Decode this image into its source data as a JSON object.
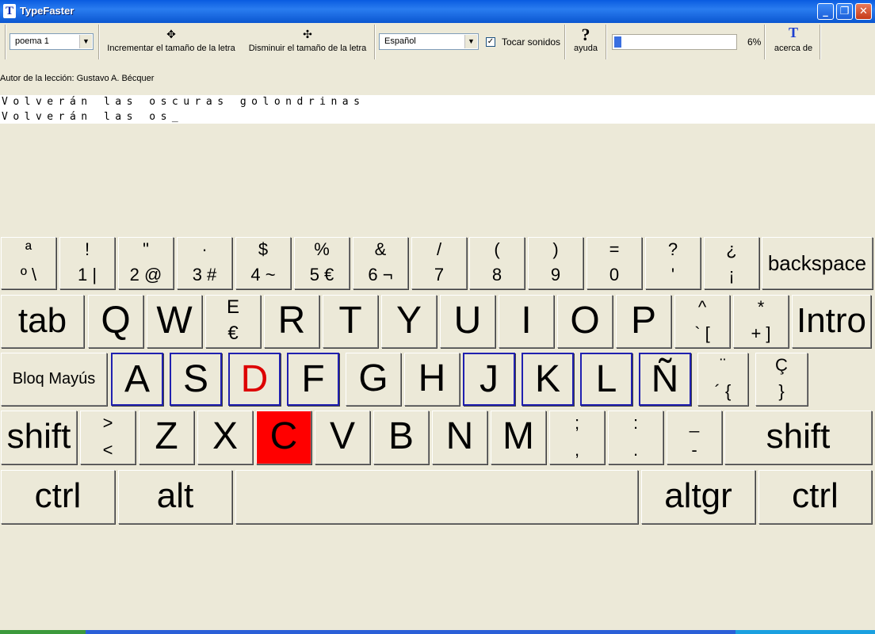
{
  "window": {
    "title": "TypeFaster",
    "icon": "T"
  },
  "toolbar": {
    "lesson_value": "poema 1",
    "increase_label": "Incrementar el tamaño de la letra",
    "decrease_label": "Disminuir el tamaño de la letra",
    "language_value": "Español",
    "sound_label": "Tocar sonidos",
    "sound_checked": true,
    "help_label": "ayuda",
    "help_icon": "?",
    "about_label": "acerca de",
    "about_icon": "T",
    "progress_percent": 6,
    "progress_label": "6%"
  },
  "author": "Autor de la lección: Gustavo A. Bécquer",
  "lesson": {
    "target": "Volverán las oscuras golondrinas",
    "typed": "Volverán las os_"
  },
  "keyboard": {
    "row1": [
      {
        "top": "ª",
        "bot": "º \\"
      },
      {
        "top": "!",
        "bot": "1 |"
      },
      {
        "top": "\"",
        "bot": "2 @"
      },
      {
        "top": "·",
        "bot": "3 #"
      },
      {
        "top": "$",
        "bot": "4 ~"
      },
      {
        "top": "%",
        "bot": "5 €"
      },
      {
        "top": "&",
        "bot": "6 ¬"
      },
      {
        "top": "/",
        "bot": "7"
      },
      {
        "top": "(",
        "bot": "8"
      },
      {
        "top": ")",
        "bot": "9"
      },
      {
        "top": "=",
        "bot": "0"
      },
      {
        "top": "?",
        "bot": "'"
      },
      {
        "top": "¿",
        "bot": "¡"
      },
      {
        "word": "backspace"
      }
    ],
    "row2": [
      {
        "word": "tab"
      },
      {
        "big": "Q"
      },
      {
        "big": "W"
      },
      {
        "top": "E",
        "bot": "€"
      },
      {
        "big": "R"
      },
      {
        "big": "T"
      },
      {
        "big": "Y"
      },
      {
        "big": "U"
      },
      {
        "big": "I"
      },
      {
        "big": "O"
      },
      {
        "big": "P"
      },
      {
        "top": "^",
        "bot": "` ["
      },
      {
        "top": "*",
        "bot": "+ ]"
      },
      {
        "word": "Intro"
      }
    ],
    "row3": [
      {
        "word": "Bloq Mayús"
      },
      {
        "big": "A"
      },
      {
        "big": "S"
      },
      {
        "big": "D"
      },
      {
        "big": "F"
      },
      {
        "big": "G"
      },
      {
        "big": "H"
      },
      {
        "big": "J"
      },
      {
        "big": "K"
      },
      {
        "big": "L"
      },
      {
        "big": "Ñ"
      },
      {
        "top": "¨",
        "bot": "´ {"
      },
      {
        "top": "Ç",
        "bot": "}"
      }
    ],
    "row4": [
      {
        "word": "shift"
      },
      {
        "top": ">",
        "bot": "<"
      },
      {
        "big": "Z"
      },
      {
        "big": "X"
      },
      {
        "big": "C"
      },
      {
        "big": "V"
      },
      {
        "big": "B"
      },
      {
        "big": "N"
      },
      {
        "big": "M"
      },
      {
        "top": ";",
        "bot": ","
      },
      {
        "top": ":",
        "bot": "."
      },
      {
        "top": "_",
        "bot": "-"
      },
      {
        "word": "shift"
      }
    ],
    "row5": [
      {
        "word": "ctrl"
      },
      {
        "word": "alt"
      },
      {
        "word": ""
      },
      {
        "word": "altgr"
      },
      {
        "word": "ctrl"
      }
    ],
    "next_key": "C",
    "next_key_color": "#ff0000",
    "home_row_color": "#2020b0",
    "next_finger_color": "#dd0000"
  }
}
